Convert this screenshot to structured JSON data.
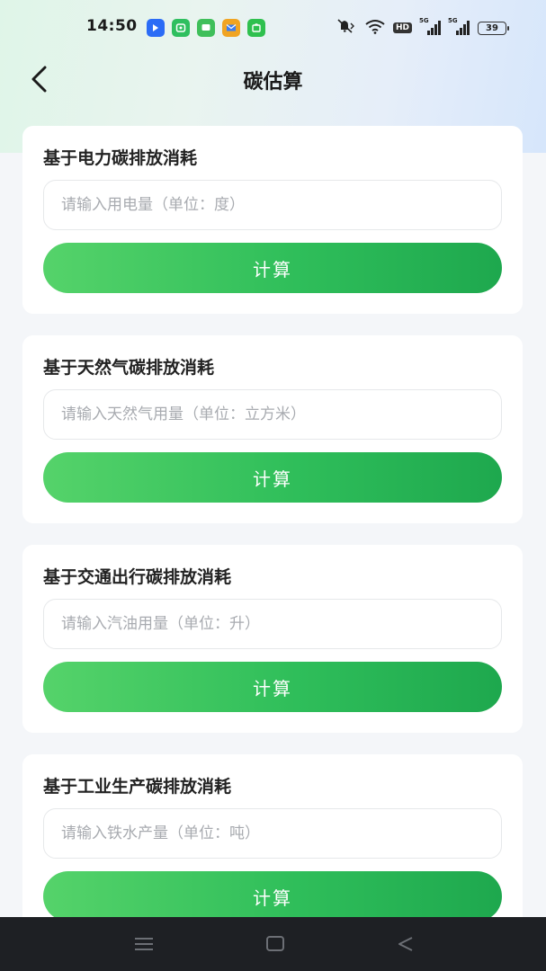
{
  "status_bar": {
    "time": "14:50",
    "network_badge": "HD",
    "signal_labels": [
      "5G",
      "5G"
    ],
    "battery": "39",
    "colors": {
      "app1": "#2b6cf6",
      "app2": "#2fbf5f",
      "app3": "#3fbf5a",
      "app4": "#f0a422",
      "app5": "#2fc04e"
    }
  },
  "header": {
    "title": "碳估算",
    "back_icon": "chevron-left-icon"
  },
  "cards": [
    {
      "title": "基于电力碳排放消耗",
      "placeholder": "请输入用电量（单位：度）",
      "value": "",
      "button_label": "计算"
    },
    {
      "title": "基于天然气碳排放消耗",
      "placeholder": "请输入天然气用量（单位：立方米）",
      "value": "",
      "button_label": "计算"
    },
    {
      "title": "基于交通出行碳排放消耗",
      "placeholder": "请输入汽油用量（单位：升）",
      "value": "",
      "button_label": "计算"
    },
    {
      "title": "基于工业生产碳排放消耗",
      "placeholder": "请输入铁水产量（单位：吨）",
      "value": "",
      "button_label": "计算"
    }
  ],
  "nav_bar": {
    "icons": [
      "menu-icon",
      "home-square-icon",
      "back-triangle-icon"
    ]
  },
  "theme": {
    "accent_start": "#55d36a",
    "accent_end": "#1ea84e",
    "page_bg": "#f4f6f9",
    "card_bg": "#ffffff"
  }
}
